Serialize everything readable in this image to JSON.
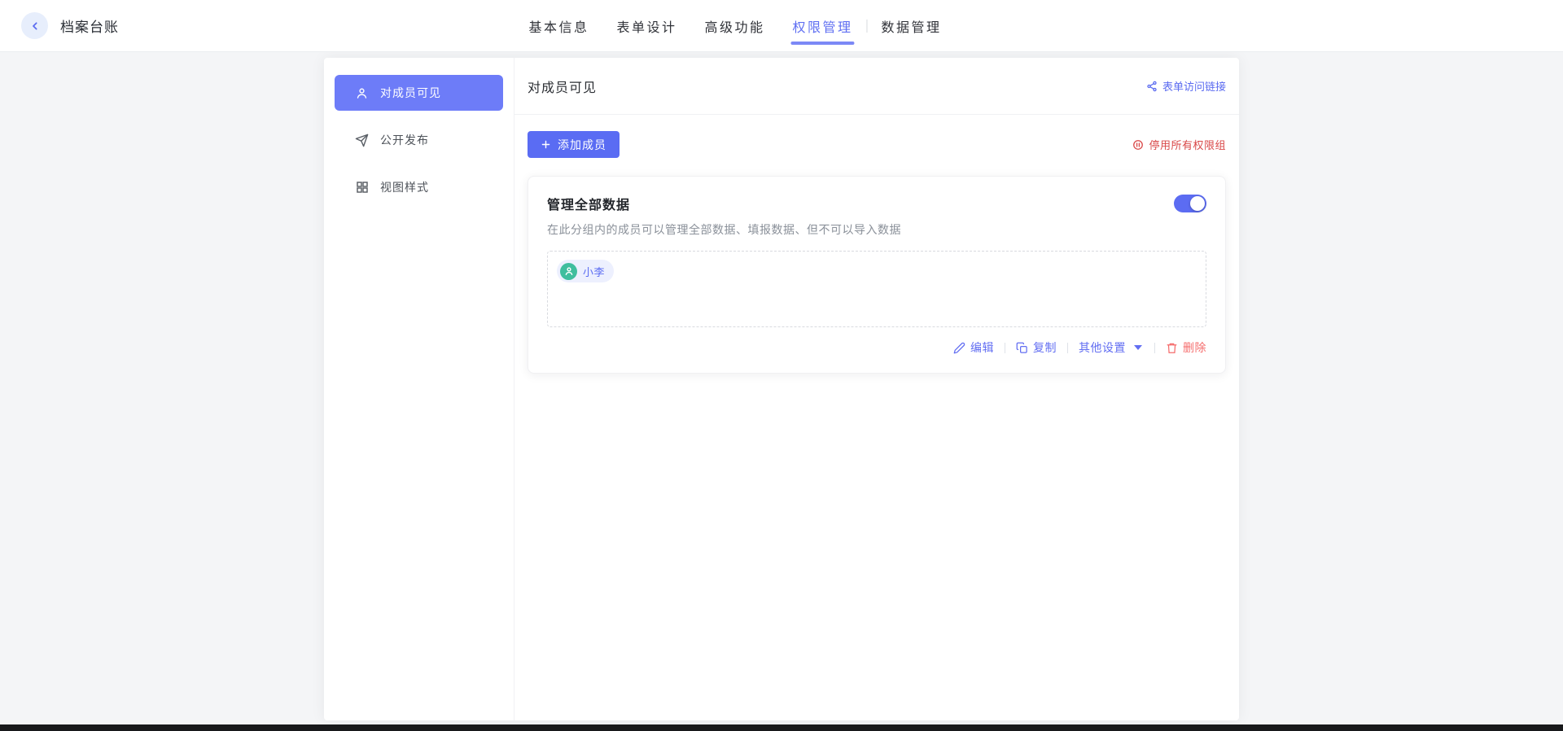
{
  "colors": {
    "primary": "#5b6cf2",
    "sidebar_active_bg": "#6d7cf8",
    "tab_underline": "#7c88f6",
    "danger_red": "#d94848",
    "delete_coral": "#f56c6c",
    "avatar_green": "#3fbe9e",
    "chip_bg": "#edf0fe",
    "back_circle_bg": "#e7eefc",
    "page_bg": "#f4f5f7"
  },
  "topbar": {
    "title": "档案台账",
    "tabs": [
      {
        "label": "基本信息",
        "active": false
      },
      {
        "label": "表单设计",
        "active": false
      },
      {
        "label": "高级功能",
        "active": false
      },
      {
        "label": "权限管理",
        "active": true
      },
      {
        "label": "数据管理",
        "active": false
      }
    ]
  },
  "sidebar": {
    "items": [
      {
        "label": "对成员可见",
        "icon": "user-icon",
        "active": true
      },
      {
        "label": "公开发布",
        "icon": "send-icon",
        "active": false
      },
      {
        "label": "视图样式",
        "icon": "grid-icon",
        "active": false
      }
    ]
  },
  "panel": {
    "title": "对成员可见",
    "access_link": "表单访问链接",
    "add_member": "添加成员",
    "disable_all": "停用所有权限组",
    "group": {
      "title": "管理全部数据",
      "enabled": true,
      "description": "在此分组内的成员可以管理全部数据、填报数据、但不可以导入数据",
      "members": [
        {
          "name": "小李"
        }
      ],
      "actions": {
        "edit": "编辑",
        "copy": "复制",
        "more": "其他设置",
        "delete": "删除"
      }
    }
  }
}
